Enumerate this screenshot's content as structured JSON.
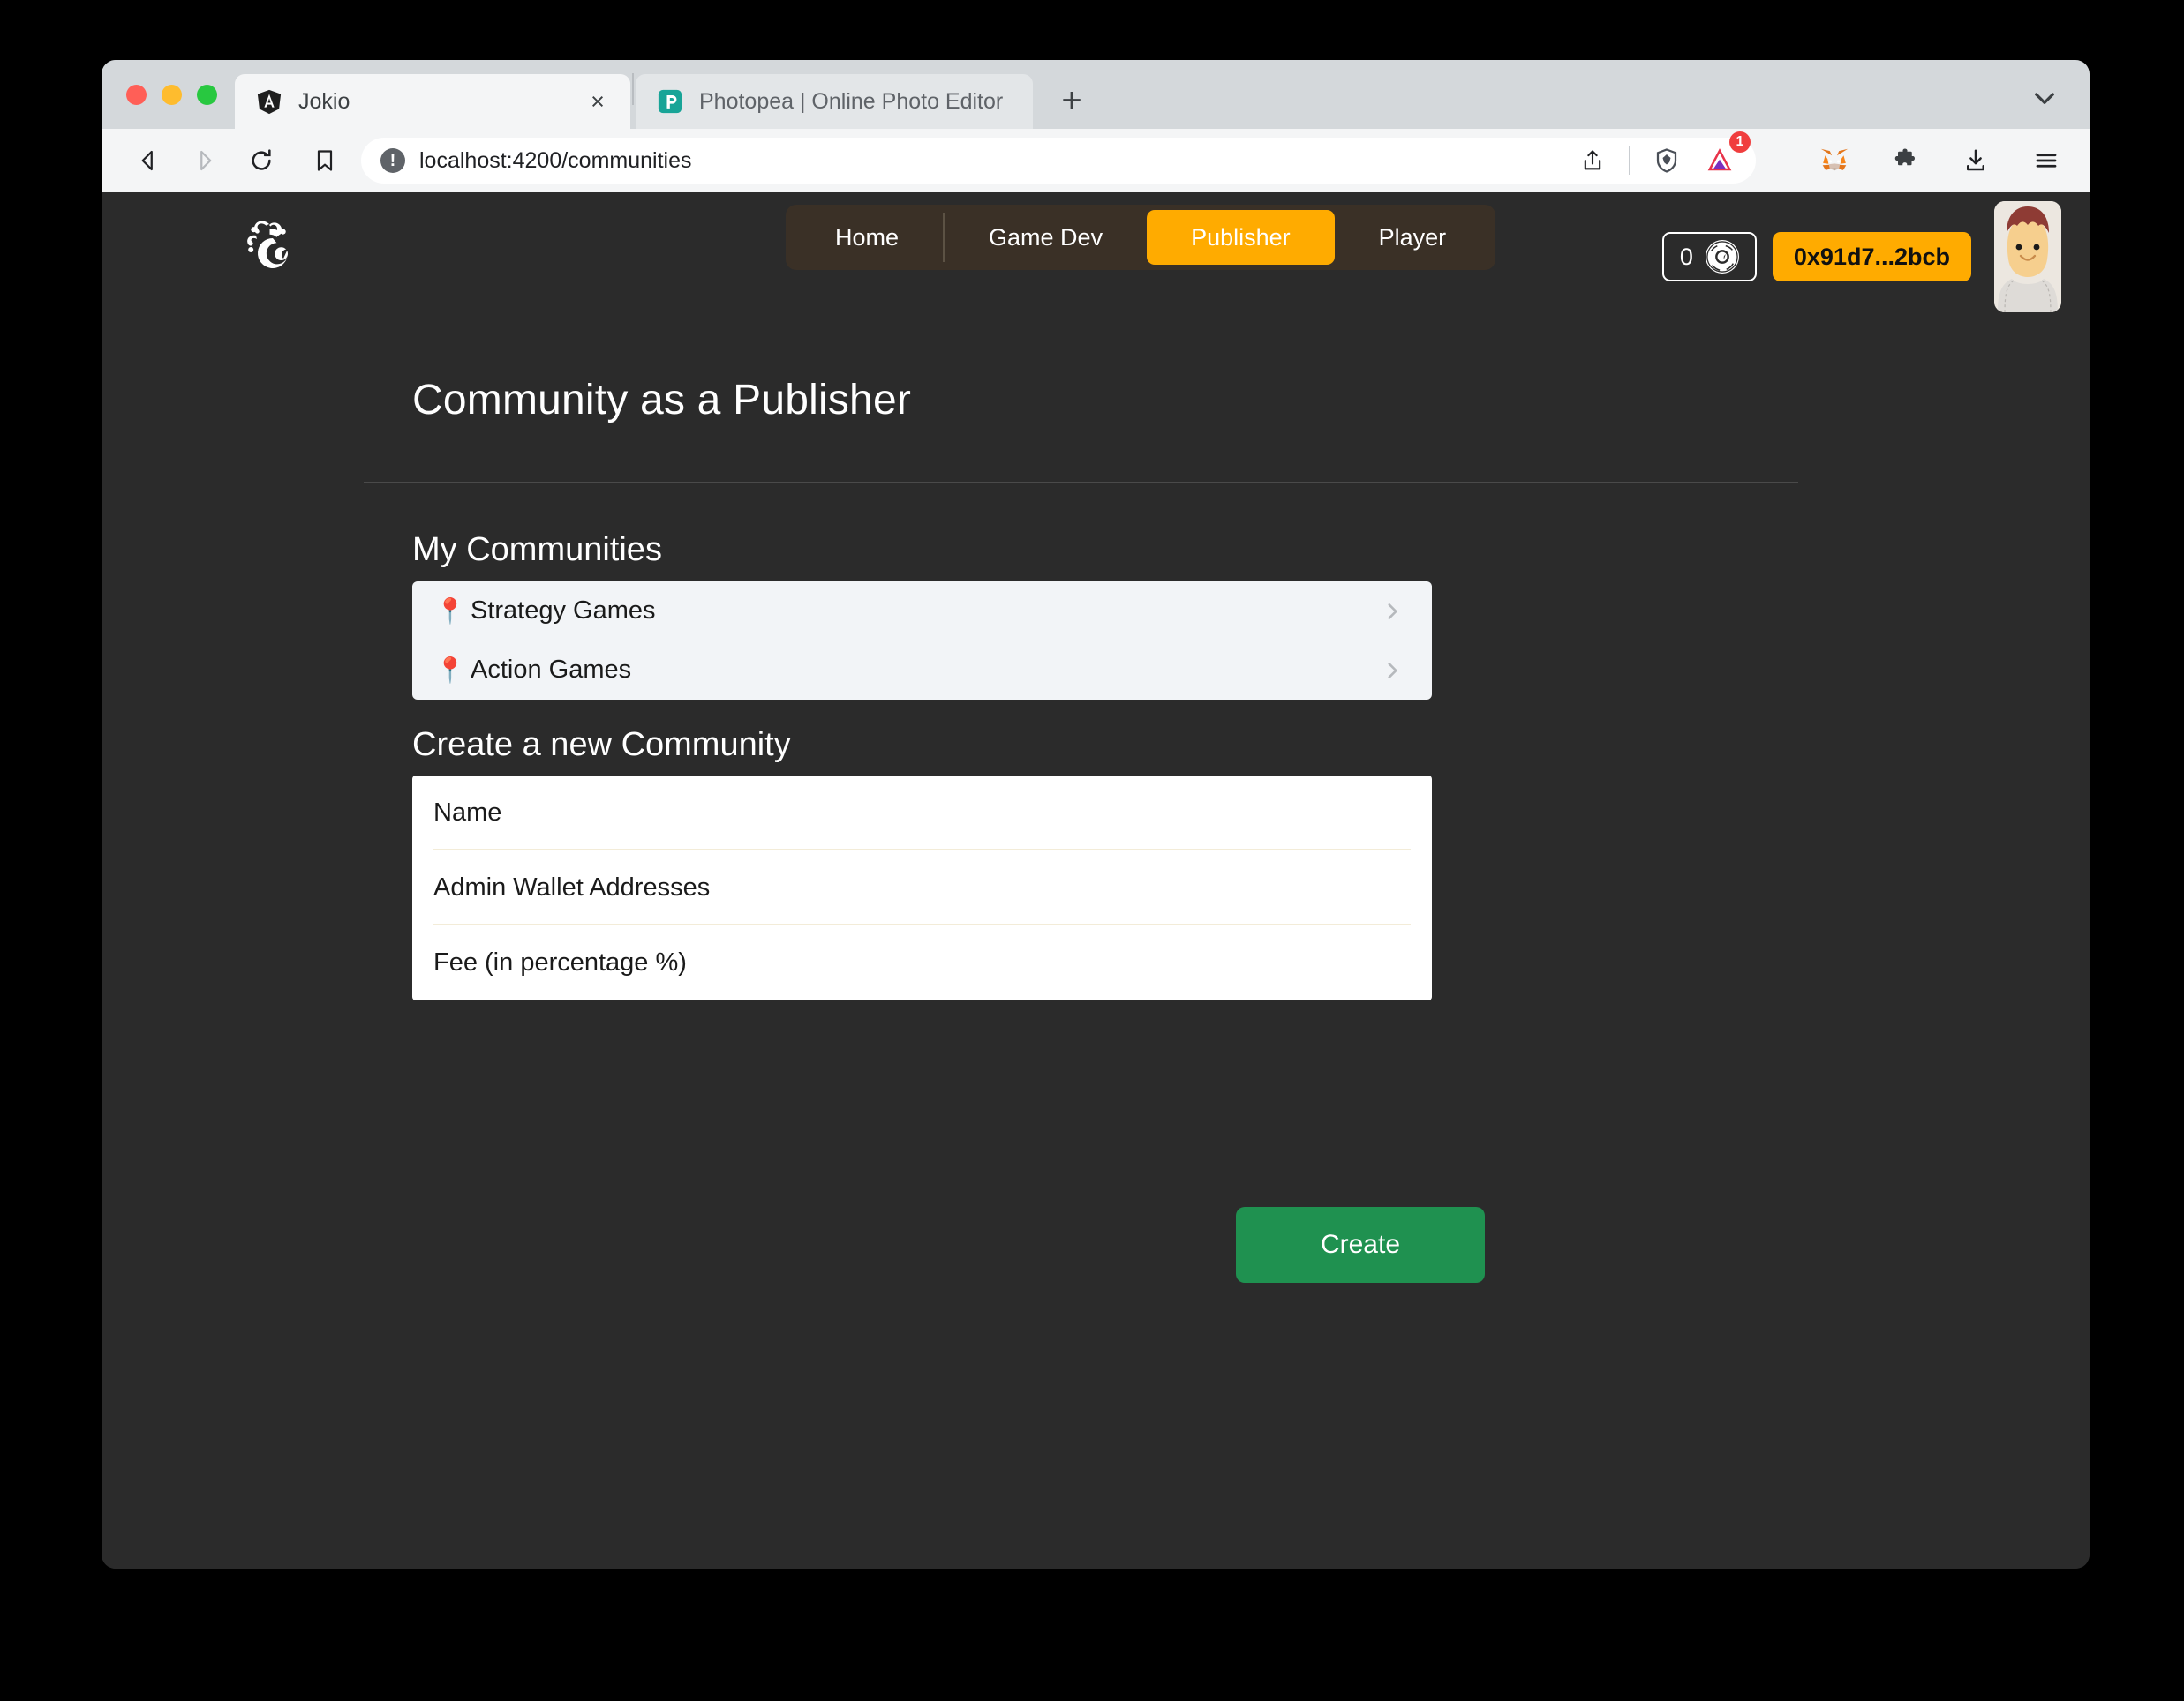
{
  "browser": {
    "tabs": [
      {
        "title": "Jokio",
        "favicon": "angular-icon",
        "active": true,
        "close_label": "×"
      },
      {
        "title": "Photopea | Online Photo Editor",
        "favicon": "photopea-icon",
        "active": false
      }
    ],
    "new_tab_label": "+",
    "toolbar": {
      "back_icon": "back-arrow-icon",
      "forward_icon": "forward-arrow-icon",
      "reload_icon": "reload-icon",
      "bookmark_icon": "bookmark-icon",
      "security_label": "!",
      "url": "localhost:4200/communities",
      "share_icon": "share-icon",
      "shield_icon": "brave-shield-icon",
      "rewards_icon": "brave-rewards-icon",
      "rewards_badge": "1",
      "metamask_icon": "metamask-fox-icon",
      "extensions_icon": "extensions-puzzle-icon",
      "downloads_icon": "downloads-icon",
      "menu_icon": "hamburger-menu-icon"
    }
  },
  "app": {
    "logo_name": "jokio-jester-logo",
    "nav": {
      "items": [
        {
          "label": "Home",
          "active": false
        },
        {
          "label": "Game Dev",
          "active": false
        },
        {
          "label": "Publisher",
          "active": true
        },
        {
          "label": "Player",
          "active": false
        }
      ]
    },
    "wallet": {
      "balance": "0",
      "coin_icon": "jokio-coin-icon",
      "address": "0x91d7...2bcb",
      "avatar_name": "user-avatar"
    },
    "page_title": "Community as a Publisher",
    "communities_section": {
      "heading": "My Communities",
      "items": [
        {
          "pin": "📍",
          "label": "Strategy Games",
          "chevron": "chevron-right-icon"
        },
        {
          "pin": "📍",
          "label": "Action Games",
          "chevron": "chevron-right-icon"
        }
      ]
    },
    "create_section": {
      "heading": "Create a new Community",
      "fields": [
        {
          "name": "name",
          "placeholder": "Name",
          "value": ""
        },
        {
          "name": "admin-wallet-addresses",
          "placeholder": "Admin Wallet Addresses",
          "value": ""
        },
        {
          "name": "fee",
          "placeholder": "Fee (in percentage %)",
          "value": ""
        }
      ],
      "submit_label": "Create"
    }
  },
  "colors": {
    "accent_orange": "#ffab00",
    "create_green": "#1f9150",
    "page_bg": "#2b2b2b",
    "card_bg": "#f2f4f7",
    "tabbar_bg": "#3a3026"
  }
}
